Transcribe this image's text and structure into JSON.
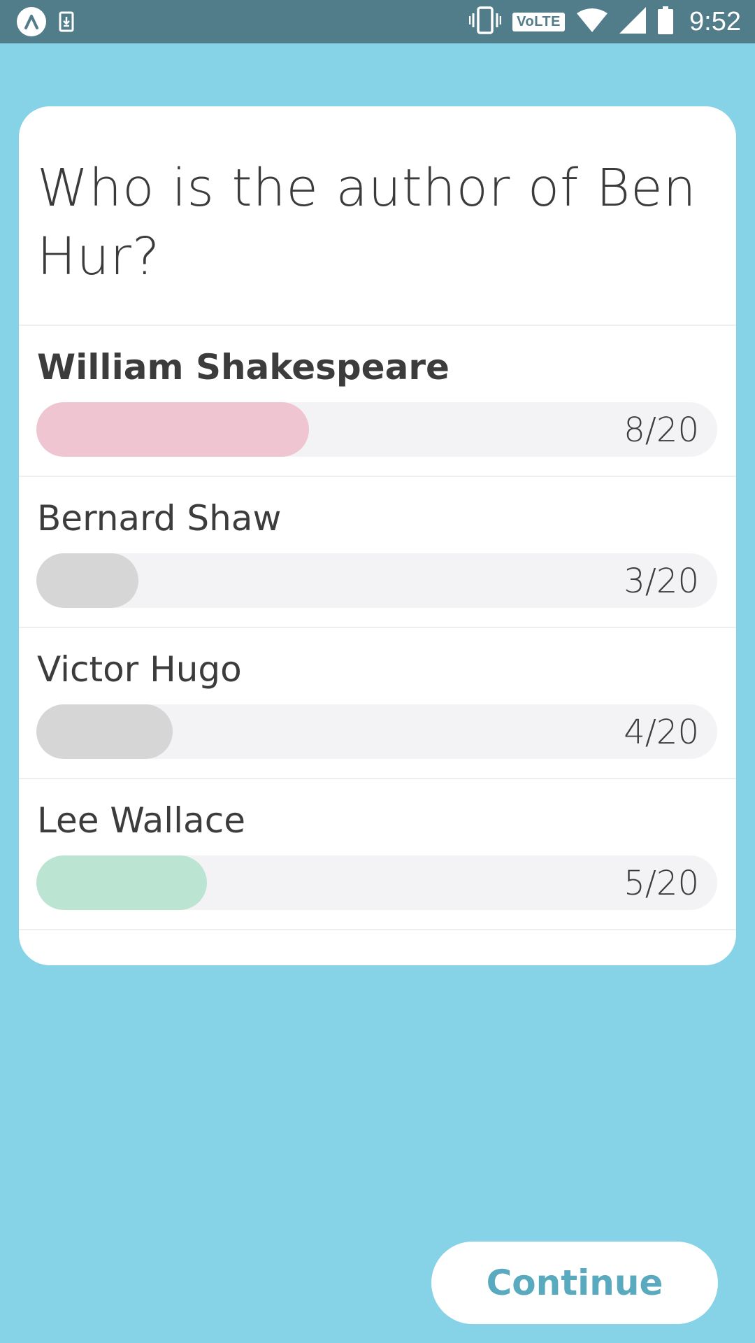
{
  "status_bar": {
    "time": "9:52",
    "network_badge": "VoLTE",
    "icons": [
      "app-logo-icon",
      "download-icon",
      "vibrate-icon",
      "wifi-icon",
      "signal-icon",
      "battery-icon"
    ]
  },
  "question": {
    "text": "Who is the author of Ben Hur?"
  },
  "options": [
    {
      "label": "William Shakespeare",
      "votes": 8,
      "total": 20,
      "count_text": "8/20",
      "fill_color": "#efc5d2",
      "selected": true
    },
    {
      "label": "Bernard Shaw",
      "votes": 3,
      "total": 20,
      "count_text": "3/20",
      "fill_color": "#d6d6d6",
      "selected": false
    },
    {
      "label": "Victor Hugo",
      "votes": 4,
      "total": 20,
      "count_text": "4/20",
      "fill_color": "#d6d6d6",
      "selected": false
    },
    {
      "label": "Lee Wallace",
      "votes": 5,
      "total": 20,
      "count_text": "5/20",
      "fill_color": "#bce4d3",
      "selected": false
    }
  ],
  "actions": {
    "continue_label": "Continue"
  },
  "colors": {
    "background": "#86d2e7",
    "status_bar": "#517c8a",
    "accent": "#59a9bf",
    "track": "#f3f3f5"
  }
}
